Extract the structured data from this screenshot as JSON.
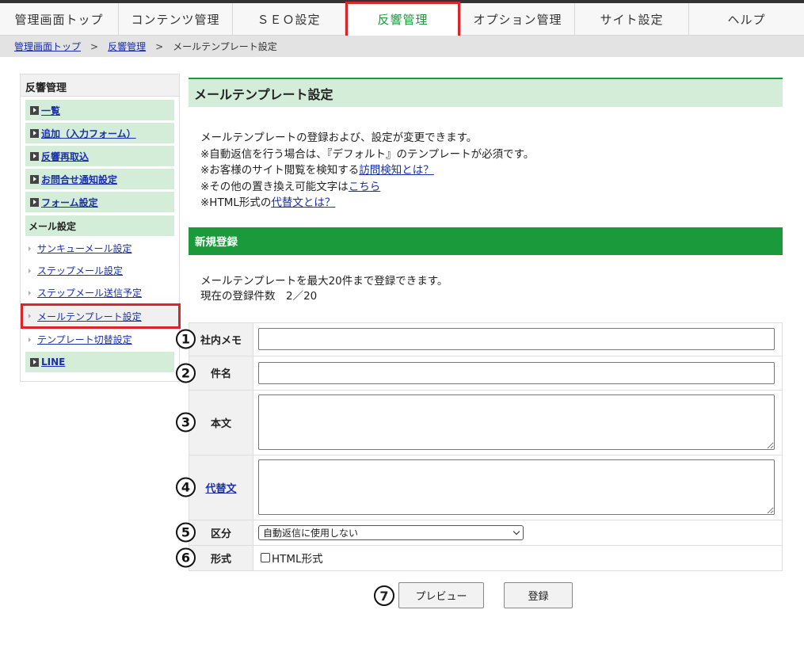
{
  "nav": {
    "items": [
      {
        "label": "管理画面トップ"
      },
      {
        "label": "コンテンツ管理"
      },
      {
        "label": "ＳＥＯ設定"
      },
      {
        "label": "反響管理"
      },
      {
        "label": "オプション管理"
      },
      {
        "label": "サイト設定"
      },
      {
        "label": "ヘルプ"
      }
    ],
    "active_index": 3,
    "active_color": "#1a9a3a",
    "highlight_color": "#d9252c"
  },
  "breadcrumb": {
    "items": [
      "管理画面トップ",
      "反響管理"
    ],
    "separator": ">",
    "current": "メールテンプレート設定"
  },
  "sidebar": {
    "title": "反響管理",
    "buttons": [
      {
        "label": "一覧"
      },
      {
        "label": "追加（入力フォーム）"
      },
      {
        "label": "反響再取込"
      },
      {
        "label": "お問合せ通知設定"
      },
      {
        "label": "フォーム設定"
      }
    ],
    "sub_title": "メール設定",
    "links": [
      {
        "label": "サンキューメール設定"
      },
      {
        "label": "ステップメール設定"
      },
      {
        "label": "ステップメール送信予定"
      },
      {
        "label": "メールテンプレート設定"
      },
      {
        "label": "テンプレート切替設定"
      }
    ],
    "current_link_index": 3,
    "bottom_button": {
      "label": "LINE"
    }
  },
  "main": {
    "title": "メールテンプレート設定",
    "intro": {
      "line1": "メールテンプレートの登録および、設定が変更できます。",
      "line2": "※自動返信を行う場合は、『デフォルト』のテンプレートが必須です。",
      "line3_prefix": "※お客様のサイト閲覧を検知する",
      "line3_link": "訪問検知とは？",
      "line4_prefix": "※その他の置き換え可能文字は",
      "line4_link": "こちら",
      "line5_prefix": "※HTML形式の",
      "line5_link": "代替文とは？"
    },
    "section_title": "新規登録",
    "count": {
      "line1": "メールテンプレートを最大20件まで登録できます。",
      "line2": "現在の登録件数　2／20"
    },
    "form": {
      "rows": [
        {
          "num": "1",
          "label": "社内メモ",
          "value": ""
        },
        {
          "num": "2",
          "label": "件名",
          "value": ""
        },
        {
          "num": "3",
          "label": "本文",
          "value": ""
        },
        {
          "num": "4",
          "label": "代替文",
          "value": ""
        },
        {
          "num": "5",
          "label": "区分",
          "selected": "自動返信に使用しない"
        },
        {
          "num": "6",
          "label": "形式",
          "checkbox_label": "HTML形式",
          "checked": false
        }
      ]
    },
    "actions": {
      "num": "7",
      "preview": "プレビュー",
      "register": "登録"
    }
  }
}
